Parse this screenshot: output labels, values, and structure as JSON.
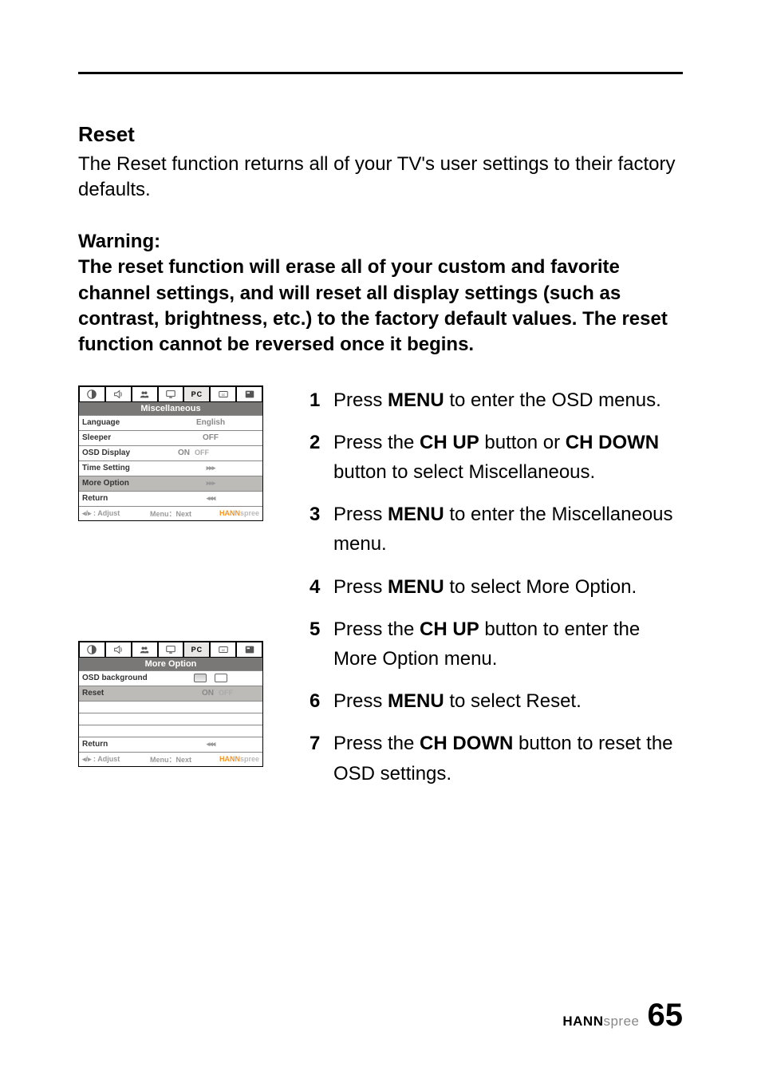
{
  "heading": "Reset",
  "intro": "The Reset function returns all of your TV's user settings to their factory defaults.",
  "warning_label": "Warning:",
  "warning_body": "The reset function will erase all of your custom and favorite channel settings, and will reset all display settings (such as contrast, brightness, etc.) to the factory default values. The reset function cannot be reversed once it begins.",
  "osd1": {
    "pc_tab": "PC",
    "title": "Miscellaneous",
    "rows": {
      "language": {
        "label": "Language",
        "value": "English"
      },
      "sleeper": {
        "label": "Sleeper",
        "value": "OFF"
      },
      "osd_display": {
        "label": "OSD Display",
        "on": "ON",
        "off": "OFF"
      },
      "time_setting": {
        "label": "Time Setting"
      },
      "more_option": {
        "label": "More Option"
      },
      "return": {
        "label": "Return"
      }
    },
    "footer": {
      "left": "◂/▸ : Adjust",
      "mid": "Menu：Next",
      "brand1": "HANN",
      "brand2": "spree"
    }
  },
  "osd2": {
    "pc_tab": "PC",
    "title": "More Option",
    "rows": {
      "osd_background": {
        "label": "OSD background"
      },
      "reset": {
        "label": "Reset",
        "on": "ON",
        "off": "OFF"
      },
      "return": {
        "label": "Return"
      }
    },
    "footer": {
      "left": "◂/▸ : Adjust",
      "mid": "Menu：Next",
      "brand1": "HANN",
      "brand2": "spree"
    }
  },
  "steps": [
    {
      "n": "1",
      "pre": "Press ",
      "b1": "MENU",
      "post1": " to enter the OSD menus."
    },
    {
      "n": "2",
      "pre": "Press the ",
      "b1": "CH UP",
      "mid": " button or ",
      "b2": "CH DOWN",
      "post2": " button to select Miscellaneous."
    },
    {
      "n": "3",
      "pre": "Press ",
      "b1": "MENU",
      "post1": " to enter the Miscellaneous menu."
    },
    {
      "n": "4",
      "pre": "Press ",
      "b1": "MENU",
      "post1": " to select More Option."
    },
    {
      "n": "5",
      "pre": "Press the ",
      "b1": "CH UP",
      "post1": " button to enter the More Option menu."
    },
    {
      "n": "6",
      "pre": "Press ",
      "b1": "MENU",
      "post1": " to select Reset."
    },
    {
      "n": "7",
      "pre": "Press the ",
      "b1": "CH DOWN",
      "post1": " button to reset the OSD settings."
    }
  ],
  "footer": {
    "brand1": "HANN",
    "brand2": "spree",
    "page": "65"
  }
}
